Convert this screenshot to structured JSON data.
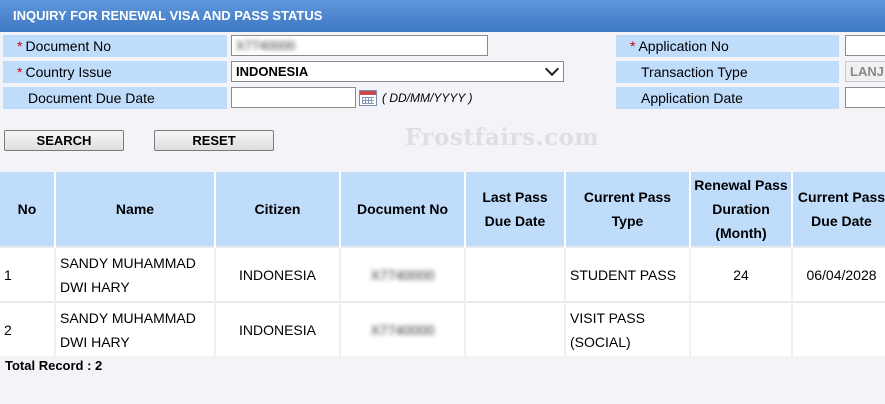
{
  "header": {
    "title": "INQUIRY FOR RENEWAL VISA AND PASS STATUS"
  },
  "form": {
    "document_no": {
      "label": "Document No",
      "value": "X7740000",
      "required": true
    },
    "country_issue": {
      "label": "Country Issue",
      "value": "INDONESIA",
      "required": true
    },
    "document_due_date": {
      "label": "Document Due Date",
      "value": "",
      "hint": "( DD/MM/YYYY )"
    },
    "application_no": {
      "label": "Application No",
      "value": "",
      "required": true
    },
    "transaction_type": {
      "label": "Transaction Type",
      "value": "LANJ"
    },
    "application_date": {
      "label": "Application Date",
      "value": ""
    }
  },
  "buttons": {
    "search": "SEARCH",
    "reset": "RESET"
  },
  "watermark": "Frostfairs.com",
  "table": {
    "headers": {
      "no": "No",
      "name": "Name",
      "citizen": "Citizen",
      "document_no": "Document No",
      "last_due": "Last Pass Due Date",
      "current_type": "Current Pass Type",
      "renewal": "Renewal Pass Duration (Month)",
      "current_due": "Current Pass Due Date"
    },
    "rows": [
      {
        "no": "1",
        "name": "SANDY MUHAMMAD DWI HARY",
        "citizen": "INDONESIA",
        "document_no": "X7740000",
        "last_due": "",
        "current_type": "STUDENT PASS",
        "renewal": "24",
        "current_due": "06/04/2028"
      },
      {
        "no": "2",
        "name": "SANDY MUHAMMAD DWI HARY",
        "citizen": "INDONESIA",
        "document_no": "X7740000",
        "last_due": "",
        "current_type": "VISIT PASS (SOCIAL)",
        "renewal": "",
        "current_due": ""
      }
    ]
  },
  "footer": {
    "total": "Total Record : 2"
  },
  "colors": {
    "header_blue": "#4f86cf",
    "label_blue": "#bfdcfb",
    "required_red": "#d00000"
  }
}
